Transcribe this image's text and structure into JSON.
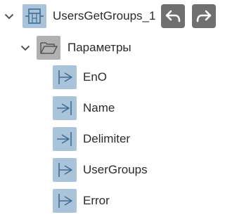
{
  "root": {
    "label": "UsersGetGroups_1",
    "icon": "function-block-icon",
    "expanded": true
  },
  "nav": {
    "back_icon": "undo-arrow-icon",
    "forward_icon": "redo-arrow-icon"
  },
  "group": {
    "label": "Параметры",
    "icon": "folder-open-icon",
    "expanded": true
  },
  "params": [
    {
      "label": "EnO",
      "direction": "output",
      "icon": "output-pin-icon"
    },
    {
      "label": "Name",
      "direction": "input",
      "icon": "input-pin-icon"
    },
    {
      "label": "Delimiter",
      "direction": "input",
      "icon": "input-pin-icon"
    },
    {
      "label": "UserGroups",
      "direction": "output",
      "icon": "output-pin-icon"
    },
    {
      "label": "Error",
      "direction": "output",
      "icon": "output-pin-icon"
    }
  ],
  "colors": {
    "icon_bg": "#a9c3da",
    "icon_stroke": "#3f6d92",
    "folder_bg": "#b1b1b1",
    "button_bg": "#707070",
    "text": "#2b2b2b",
    "chevron": "#555555"
  }
}
